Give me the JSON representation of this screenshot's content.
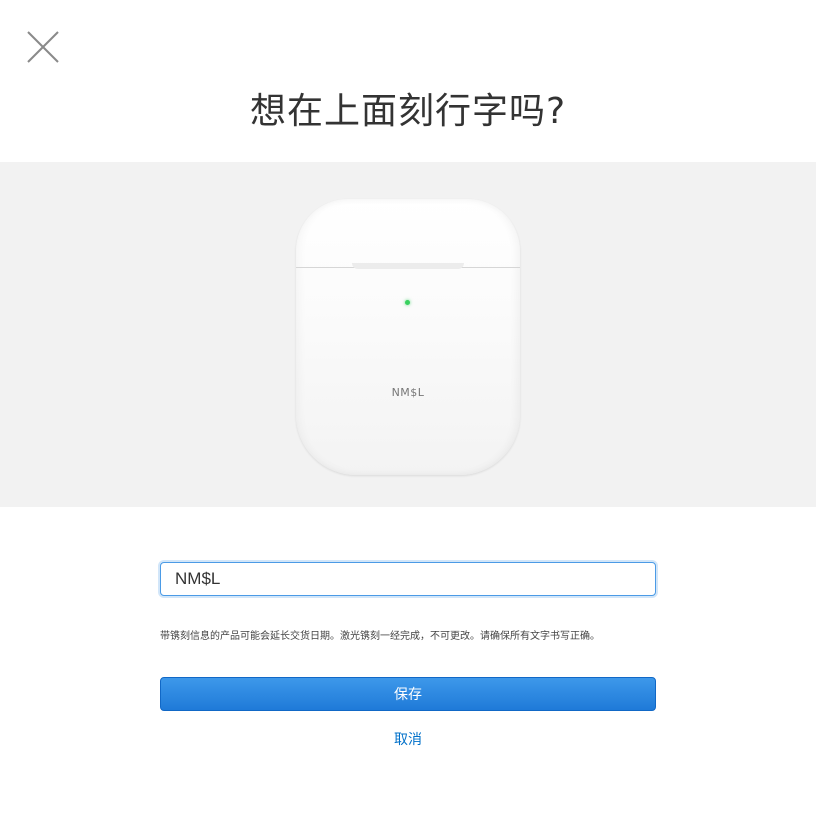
{
  "dialog": {
    "close_icon": "close-icon",
    "title": "想在上面刻行字吗?"
  },
  "product": {
    "name": "airpods-charging-case",
    "led_color": "#39d15f",
    "engraving_preview": "NM$L"
  },
  "form": {
    "engraving_value": "NM$L",
    "notice": "带镌刻信息的产品可能会延长交货日期。激光镌刻一经完成，不可更改。请确保所有文字书写正确。",
    "save_label": "保存",
    "cancel_label": "取消"
  },
  "colors": {
    "accent": "#1f7ad8",
    "link": "#0070c9",
    "product_bg": "#f2f2f2"
  }
}
